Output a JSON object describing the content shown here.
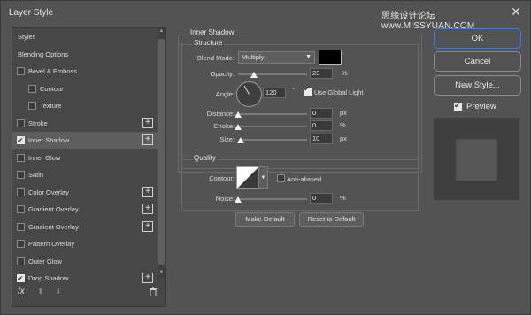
{
  "window": {
    "title": "Layer Style",
    "watermark": "思缘设计论坛 www.MISSYUAN.COM",
    "close_glyph": "✕"
  },
  "sidebar": {
    "items": [
      {
        "label": "Styles",
        "checkbox": false,
        "checked": false,
        "plus": false,
        "indent": 0,
        "selected": false
      },
      {
        "label": "Blending Options",
        "checkbox": false,
        "checked": false,
        "plus": false,
        "indent": 0,
        "selected": false
      },
      {
        "label": "Bevel & Emboss",
        "checkbox": true,
        "checked": false,
        "plus": false,
        "indent": 0,
        "selected": false
      },
      {
        "label": "Contour",
        "checkbox": true,
        "checked": false,
        "plus": false,
        "indent": 1,
        "selected": false
      },
      {
        "label": "Texture",
        "checkbox": true,
        "checked": false,
        "plus": false,
        "indent": 1,
        "selected": false
      },
      {
        "label": "Stroke",
        "checkbox": true,
        "checked": false,
        "plus": true,
        "indent": 0,
        "selected": false
      },
      {
        "label": "Inner Shadow",
        "checkbox": true,
        "checked": true,
        "plus": true,
        "indent": 0,
        "selected": true
      },
      {
        "label": "Inner Glow",
        "checkbox": true,
        "checked": false,
        "plus": false,
        "indent": 0,
        "selected": false
      },
      {
        "label": "Satin",
        "checkbox": true,
        "checked": false,
        "plus": false,
        "indent": 0,
        "selected": false
      },
      {
        "label": "Color Overlay",
        "checkbox": true,
        "checked": false,
        "plus": true,
        "indent": 0,
        "selected": false
      },
      {
        "label": "Gradient Overlay",
        "checkbox": true,
        "checked": false,
        "plus": true,
        "indent": 0,
        "selected": false
      },
      {
        "label": "Gradient Overlay",
        "checkbox": true,
        "checked": false,
        "plus": true,
        "indent": 0,
        "selected": false
      },
      {
        "label": "Pattern Overlay",
        "checkbox": true,
        "checked": false,
        "plus": false,
        "indent": 0,
        "selected": false
      },
      {
        "label": "Outer Glow",
        "checkbox": true,
        "checked": false,
        "plus": false,
        "indent": 0,
        "selected": false
      },
      {
        "label": "Drop Shadow",
        "checkbox": true,
        "checked": true,
        "plus": true,
        "indent": 0,
        "selected": false
      }
    ],
    "footer": {
      "fx_label": "fx",
      "fx_icon": "fx-icon",
      "up_icon": "arrow-up-icon",
      "down_icon": "arrow-down-icon",
      "trash_icon": "trash-icon"
    }
  },
  "inner_shadow": {
    "section_title": "Inner Shadow",
    "structure_title": "Structure",
    "blend_mode_label": "Blend Mode:",
    "blend_mode_value": "Multiply",
    "shadow_color": "#000000",
    "opacity_label": "Opacity:",
    "opacity_value": "23",
    "opacity_level": 0.23,
    "angle_label": "Angle:",
    "angle_value": "120",
    "angle_degrees": 120,
    "degree_symbol": "°",
    "use_global_light_label": "Use Global Light",
    "use_global_light_checked": true,
    "distance_label": "Distance:",
    "distance_value": "0",
    "distance_level": 0,
    "choke_label": "Choke:",
    "choke_value": "0",
    "choke_level": 0,
    "size_label": "Size:",
    "size_value": "10",
    "size_level": 0.04,
    "unit_percent": "%",
    "unit_px": "px",
    "quality_title": "Quality",
    "contour_label": "Contour:",
    "anti_aliased_label": "Anti-aliased",
    "anti_aliased_checked": false,
    "noise_label": "Noise:",
    "noise_value": "0",
    "noise_level": 0,
    "make_default_label": "Make Default",
    "reset_default_label": "Reset to Default"
  },
  "actions": {
    "ok_label": "OK",
    "cancel_label": "Cancel",
    "new_style_label": "New Style...",
    "preview_label": "Preview",
    "preview_checked": true
  },
  "colors": {
    "background": "#535353",
    "sidebar": "#474747",
    "selected_row": "#5d5d5d",
    "ok_border": "#4b7bc7"
  }
}
